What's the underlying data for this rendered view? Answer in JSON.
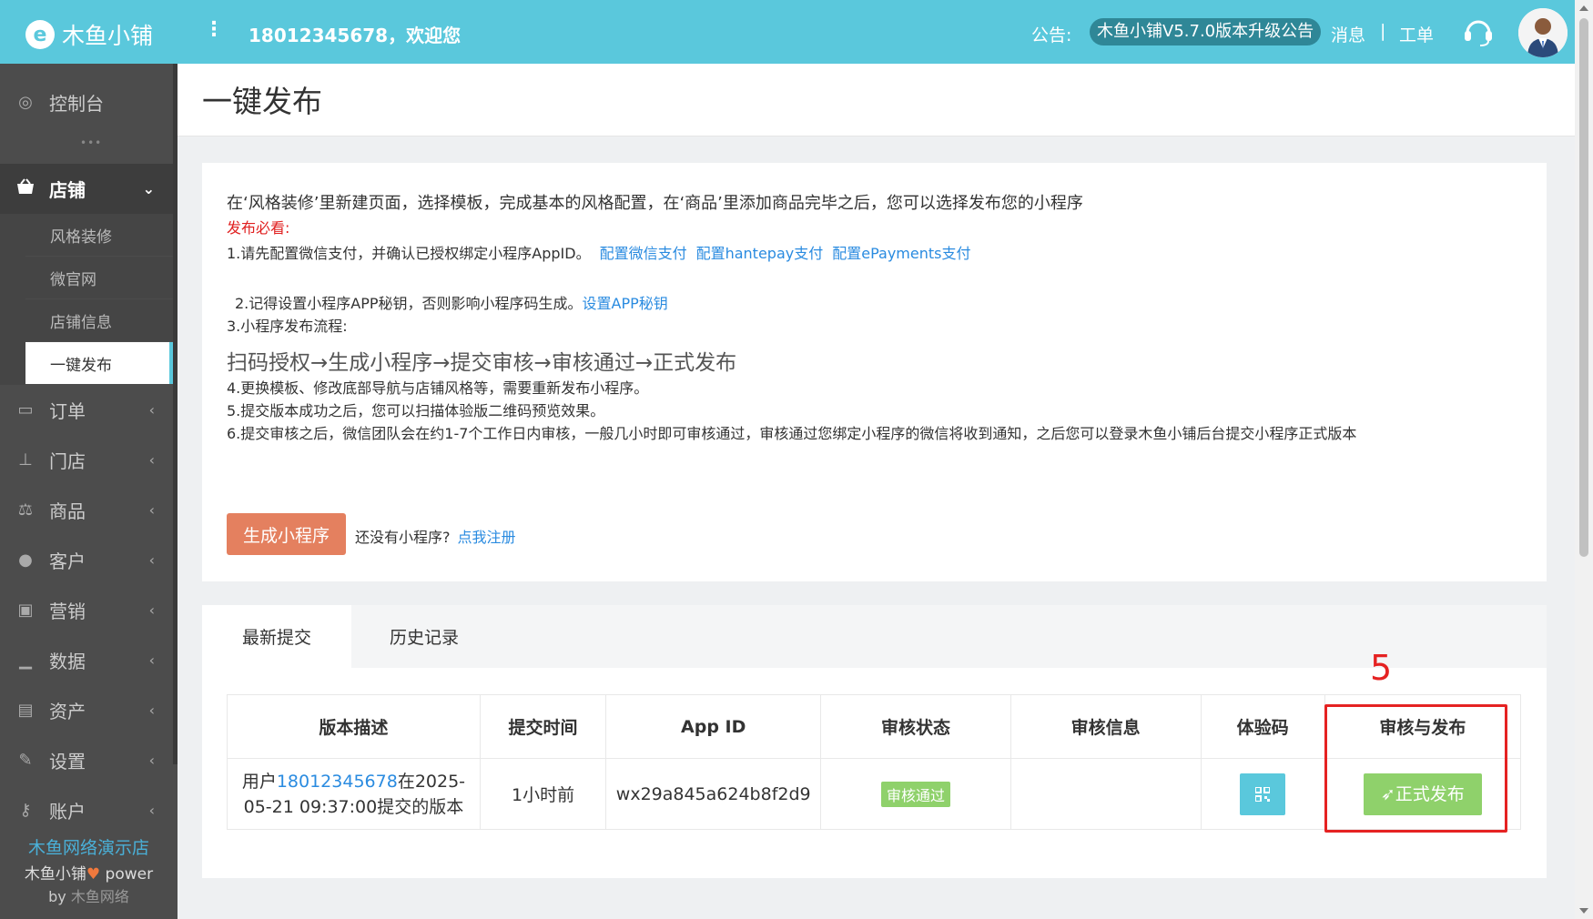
{
  "header": {
    "logo_mark": "e",
    "logo_text": "木鱼小铺",
    "menu_glyph": "⋮",
    "welcome": "18012345678，欢迎您",
    "notice_label": "公告:",
    "notice_text": "木鱼小铺V5.7.0版本升级公告",
    "messages": "消息",
    "separator": "|",
    "ticket": "工单"
  },
  "sidebar": {
    "dashboard": "控制台",
    "dots": "•••",
    "store": "店铺",
    "store_sub": [
      "风格装修",
      "微官网",
      "店铺信息",
      "一键发布"
    ],
    "items": [
      "订单",
      "门店",
      "商品",
      "客户",
      "营销",
      "数据",
      "资产",
      "设置",
      "账户"
    ],
    "footer_shop": "木鱼网络演示店",
    "footer_power_a": "木鱼小铺",
    "footer_heart": "♥",
    "footer_power_b": " power",
    "footer_by": "by ",
    "footer_by_name": "木鱼网络"
  },
  "page": {
    "title": "一键发布"
  },
  "intro": {
    "text": "在‘风格装修’里新建页面，选择模板，完成基本的风格配置，在‘商品’里添加商品完毕之后，您可以选择发布您的小程序",
    "must": "发布必看:",
    "step1": "1.请先配置微信支付，并确认已授权绑定小程序AppID。",
    "link_wechat": "配置微信支付",
    "link_hantepay": "配置hantepay支付",
    "link_epayments": "配置ePayments支付",
    "step2": "2.记得设置小程序APP秘钥，否则影响小程序码生成。",
    "link_secret": "设置APP秘钥",
    "step3": "3.小程序发布流程:",
    "flow": "扫码授权→生成小程序→提交审核→审核通过→正式发布",
    "step4": "4.更换模板、修改底部导航与店铺风格等，需要重新发布小程序。",
    "step5": "5.提交版本成功之后，您可以扫描体验版二维码预览效果。",
    "step6": "6.提交审核之后，微信团队会在约1-7个工作日内审核，一般几小时即可审核通过，审核通过您绑定小程序的微信将收到通知，之后您可以登录木鱼小铺后台提交小程序正式版本",
    "generate_button": "生成小程序",
    "no_app": "还没有小程序?",
    "register_link": "点我注册"
  },
  "tabs": {
    "latest": "最新提交",
    "history": "历史记录"
  },
  "table": {
    "headers": [
      "版本描述",
      "提交时间",
      "App ID",
      "审核状态",
      "审核信息",
      "体验码",
      "审核与发布"
    ],
    "row": {
      "desc_prefix": "用户",
      "desc_phone": "18012345678",
      "desc_suffix": "在2025-05-21 09:37:00提交的版本",
      "time": "1小时前",
      "app_id": "wx29a845a624b8f2d9",
      "status": "审核通过",
      "info": "",
      "publish": "正式发布"
    }
  },
  "annotation": {
    "number": "5"
  }
}
